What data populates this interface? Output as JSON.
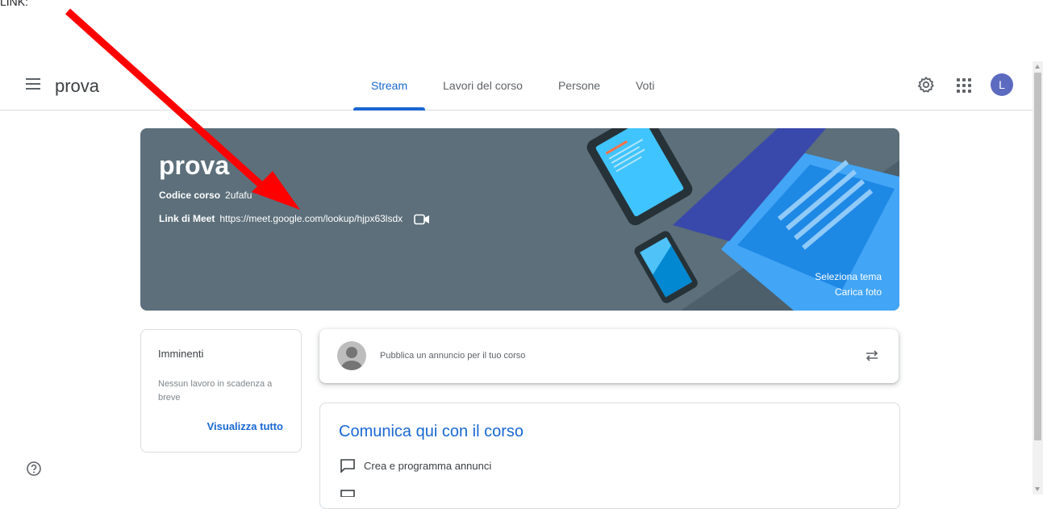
{
  "caption": "LINK:",
  "header": {
    "app_title": "prova",
    "tabs": [
      {
        "label": "Stream",
        "active": true
      },
      {
        "label": "Lavori del corso",
        "active": false
      },
      {
        "label": "Persone",
        "active": false
      },
      {
        "label": "Voti",
        "active": false
      }
    ],
    "avatar_letter": "L",
    "icons": [
      "menu-icon",
      "gear-icon",
      "apps-grid-icon"
    ]
  },
  "banner": {
    "title": "prova",
    "code_label": "Codice corso",
    "code_value": "2ufafu",
    "meet_label": "Link di Meet",
    "meet_value": "https://meet.google.com/lookup/hjpx63lsdx",
    "select_theme": "Seleziona tema",
    "upload_photo": "Carica foto",
    "background_color": "#5c6f7a"
  },
  "upcoming": {
    "title": "Imminenti",
    "text": "Nessun lavoro in scadenza a breve",
    "link": "Visualizza tutto"
  },
  "announce": {
    "placeholder": "Pubblica un annuncio per il tuo corso"
  },
  "communicate": {
    "title": "Comunica qui con il corso",
    "item": "Crea e programma annunci"
  },
  "colors": {
    "accent": "#1967d2",
    "annotation_arrow": "#ff0000"
  }
}
